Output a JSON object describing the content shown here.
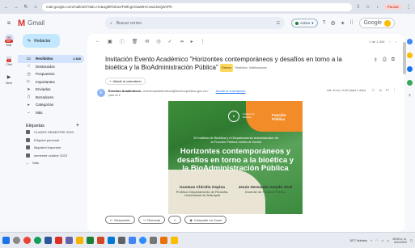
{
  "browser": {
    "url": "mail.google.com/mail/u/0/?tab=rm&ogbl#inbox/FMfcgzGtwMHCvwZJwQwVPb",
    "profile_label": "Pausar"
  },
  "app": {
    "logo_text": "Gmail",
    "search_placeholder": "Buscar correo",
    "status_label": "Activo",
    "google_label": "Google"
  },
  "rail": [
    {
      "label": "Mail",
      "badge": "99+"
    },
    {
      "label": "Chat",
      "badge": "1"
    },
    {
      "label": "Meet",
      "badge": ""
    }
  ],
  "sidebar": {
    "compose_label": "Redactar",
    "nav": [
      {
        "label": "Recibidos",
        "count": "1.340",
        "active": true
      },
      {
        "label": "Destacados",
        "count": ""
      },
      {
        "label": "Pospuestos",
        "count": ""
      },
      {
        "label": "Importantes",
        "count": ""
      },
      {
        "label": "Enviados",
        "count": ""
      },
      {
        "label": "Borradores",
        "count": ""
      },
      {
        "label": "Categorías",
        "count": ""
      },
      {
        "label": "Más",
        "count": ""
      }
    ],
    "labels_heading": "Etiquetas",
    "labels": [
      {
        "label": "CLASES SEMESTRE 2023"
      },
      {
        "label": "Etiqueta personal"
      },
      {
        "label": "Migrated important"
      },
      {
        "label": "semestre octubre 2023"
      },
      {
        "label": "Más"
      }
    ]
  },
  "toolbar": {
    "pagination": "1 de 1.340"
  },
  "email": {
    "subject": "Invitación Evento Académico \"Horizontes contemporáneos y desafíos en torno a la bioética y la BioAdministración Pública\"",
    "tag_external": "Externo",
    "tag_inbox": "Recibidos",
    "tag_notifications": "Notificaciones",
    "add_calendar_label": "Añadir al calendario",
    "sender_name": "Eventos Académicos",
    "sender_email": "<eventosacademicos@funcionpublica.gov.co>",
    "unsubscribe_label": "Anular la suscripción",
    "to_line": "para mí",
    "date": "mié, 8 nov, 10:00 (hace 3 días)",
    "reply_label": "Responder",
    "forward_label": "Reenviar",
    "share_label": "Compartir en Zoom"
  },
  "poster": {
    "institute": "Instituto de Bioética",
    "institution_label": "Función Pública",
    "intro": "El Instituto de Bioética y el Departamento Administrativo de la Función Pública invitan al evento",
    "title": "Horizontes contemporáneos y desafíos en torno a la bioética y la BioAdministración Pública",
    "speaker1_name": "Gustavo Chirolla Ospina",
    "speaker1_role": "Profesor Departamento de Filosofía, Universidad de Antioquia",
    "speaker2_name": "Jesús Hernando Amado Abril",
    "speaker2_role": "Docente de Función Pública"
  },
  "taskbar": {
    "weather": "18°C Nublado",
    "time": "10:00 a. m.",
    "date": "8/11/2023"
  },
  "colors": {
    "gmail_red": "#d93025",
    "poster_green": "#3e8e3a",
    "poster_orange": "#f28c28",
    "active_nav": "#d3e3fd",
    "compose_bg": "#c2e7ff"
  }
}
